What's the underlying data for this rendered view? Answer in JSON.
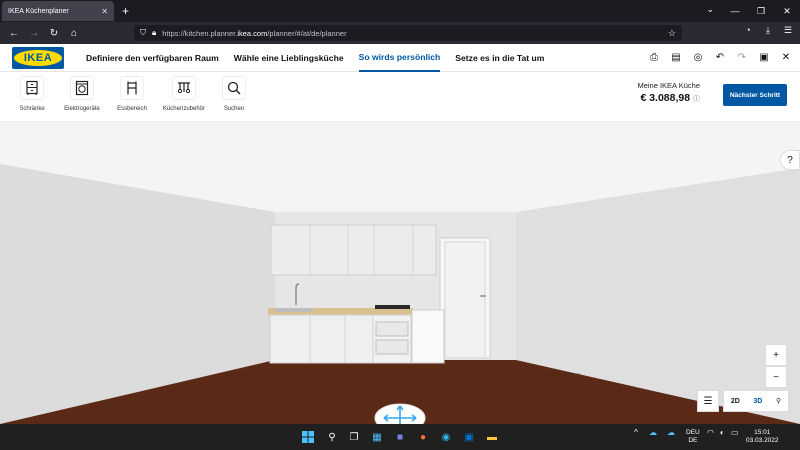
{
  "browser": {
    "tab_title": "IKEA Küchenplaner",
    "tab_close": "✕",
    "new_tab": "+",
    "url_prefix": "https://kitchen.planner.",
    "url_host": "ikea.com",
    "url_suffix": "/planner/#/at/de/planner"
  },
  "header": {
    "logo_text": "IKEA",
    "steps": [
      "Definiere den verfügbaren Raum",
      "Wähle eine Lieblingsküche",
      "So wirds persönlich",
      "Setze es in die Tat um"
    ],
    "active_step_index": 2,
    "accent_color": "#0058a3"
  },
  "toolbar": {
    "tools": [
      {
        "label": "Schränke",
        "icon": "cabinet-icon"
      },
      {
        "label": "Elektrogeräte",
        "icon": "appliance-icon"
      },
      {
        "label": "Essbereich",
        "icon": "chair-icon"
      },
      {
        "label": "Küchenzubehör",
        "icon": "utensils-icon"
      },
      {
        "label": "Suchen",
        "icon": "search-icon"
      }
    ],
    "cart_label": "Meine IKEA Küche",
    "cart_price": "€ 3.088,98",
    "next_button": "Nächster Schritt"
  },
  "view": {
    "help": "?",
    "zoom_in": "+",
    "zoom_out": "−",
    "mode_2d": "2D",
    "mode_3d": "3D"
  },
  "taskbar": {
    "lang_top": "DEU",
    "lang_bottom": "DE",
    "time": "15:01",
    "date": "03.03.2022"
  }
}
